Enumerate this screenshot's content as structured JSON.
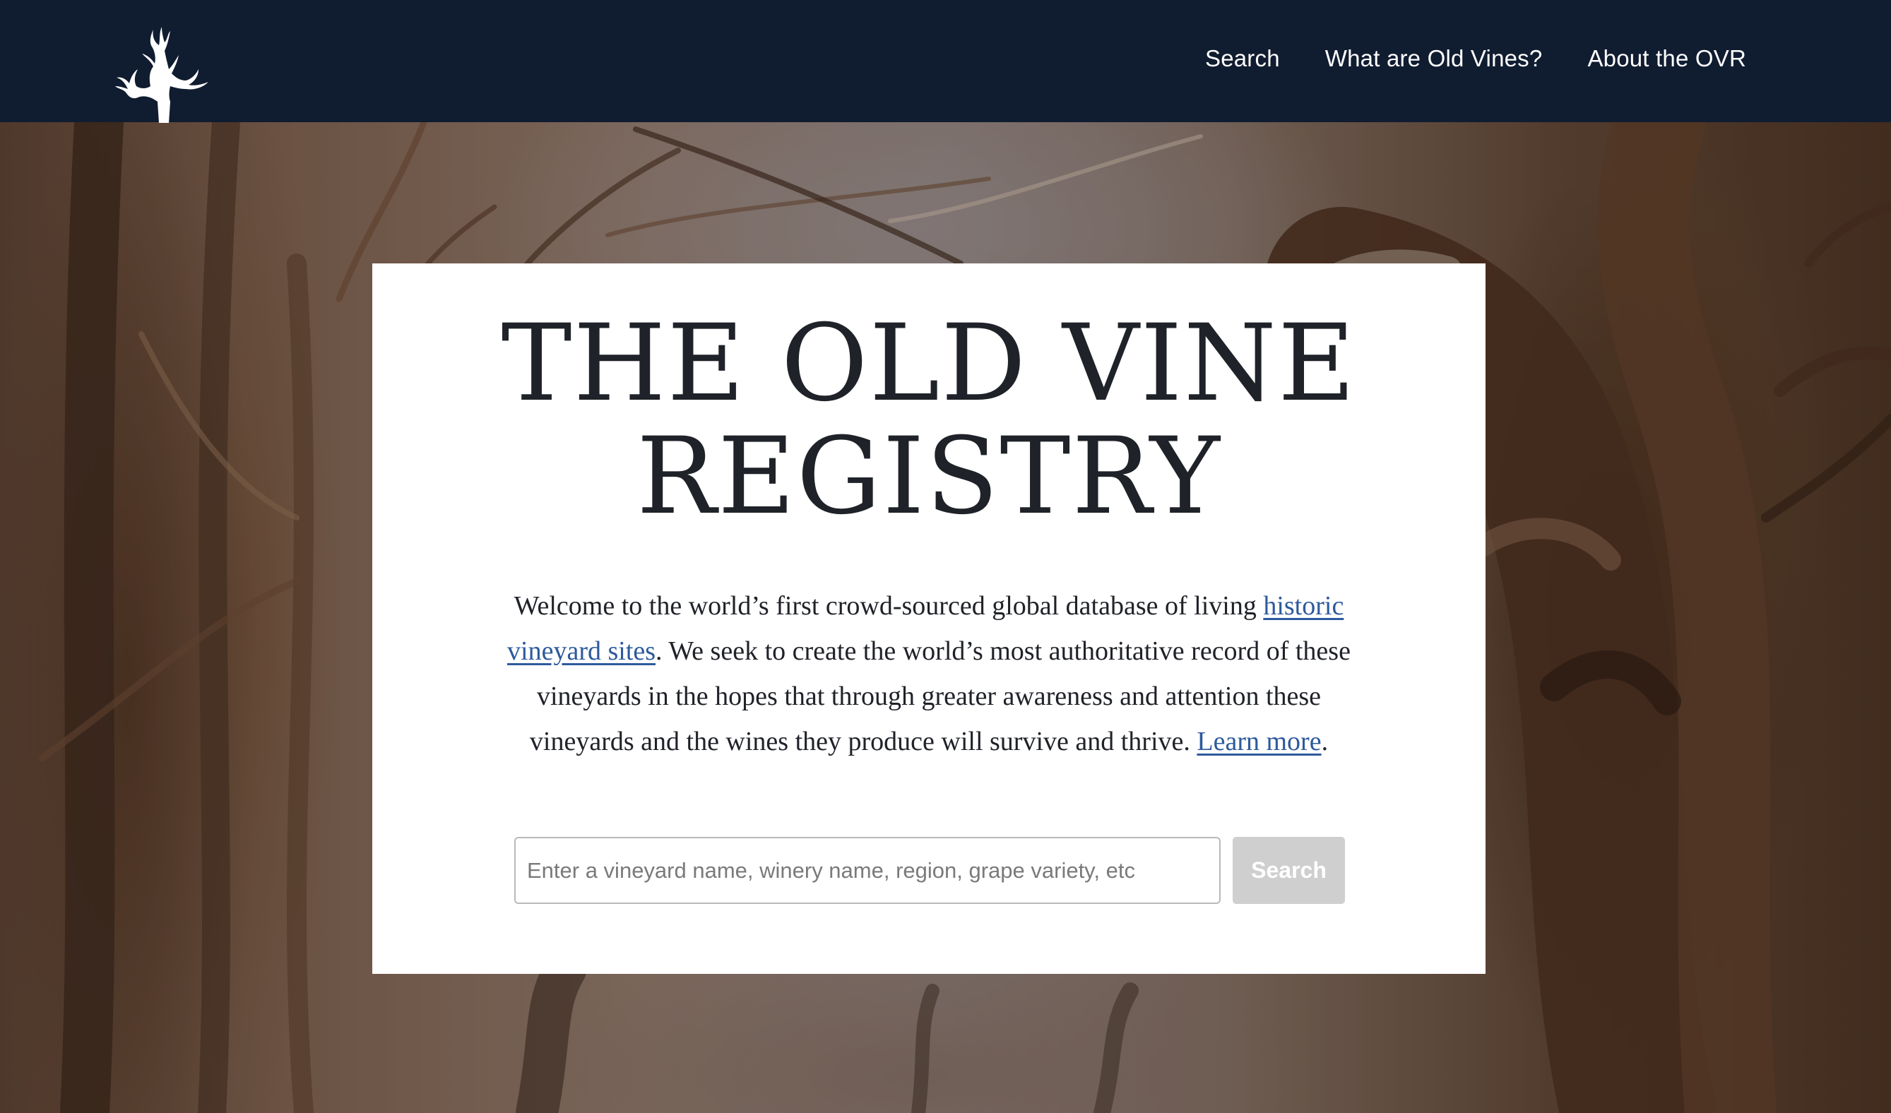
{
  "nav": {
    "logo_alt": "Old Vine Registry logo",
    "links": [
      {
        "label": "Search"
      },
      {
        "label": "What are Old Vines?"
      },
      {
        "label": "About the OVR"
      }
    ]
  },
  "hero": {
    "title_line1": "THE OLD VINE",
    "title_line2": "REGISTRY",
    "intro_before_link": "Welcome to the world’s first crowd-sourced global database of living ",
    "intro_link1": "historic vineyard sites",
    "intro_middle": ". We seek to create the world’s most authoritative record of these vineyards in the hopes that through greater awareness and attention these vineyards and the wines they produce will survive and thrive. ",
    "intro_link2": "Learn more",
    "intro_end": "."
  },
  "search": {
    "placeholder": "Enter a vineyard name, winery name, region, grape variety, etc",
    "button_label": "Search"
  },
  "colors": {
    "navbar": "#101c30",
    "link": "#2d5a9c",
    "button_disabled": "#cfcfcf"
  }
}
